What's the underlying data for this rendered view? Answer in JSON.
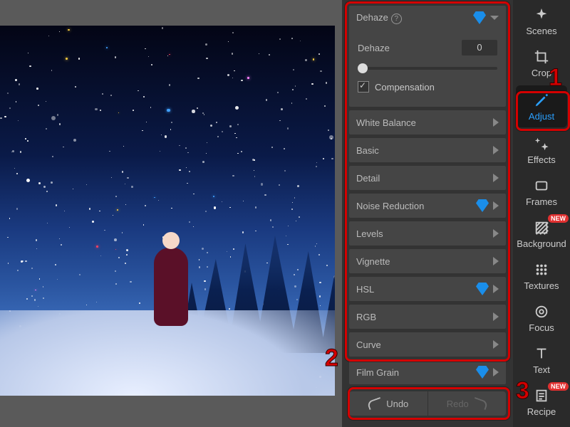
{
  "panelGroup": {
    "dehaze": {
      "header": "Dehaze",
      "hasHelp": true,
      "hasDiamond": true,
      "param_label": "Dehaze",
      "param_value": "0",
      "comp_label": "Compensation",
      "comp_checked": true
    },
    "items": [
      {
        "label": "White Balance",
        "diamond": false
      },
      {
        "label": "Basic",
        "diamond": false
      },
      {
        "label": "Detail",
        "diamond": false
      },
      {
        "label": "Noise Reduction",
        "diamond": true
      },
      {
        "label": "Levels",
        "diamond": false
      },
      {
        "label": "Vignette",
        "diamond": false
      },
      {
        "label": "HSL",
        "diamond": true
      },
      {
        "label": "RGB",
        "diamond": false
      },
      {
        "label": "Curve",
        "diamond": false
      },
      {
        "label": "Film Grain",
        "diamond": true
      }
    ]
  },
  "undo": {
    "undo_label": "Undo",
    "redo_label": "Redo"
  },
  "tools": [
    {
      "label": "Scenes",
      "icon": "sparkle",
      "new": false
    },
    {
      "label": "Crop",
      "icon": "crop",
      "new": false
    },
    {
      "label": "Adjust",
      "icon": "pencil",
      "new": false,
      "active": true
    },
    {
      "label": "Effects",
      "icon": "sparkles",
      "new": false
    },
    {
      "label": "Frames",
      "icon": "rect",
      "new": false
    },
    {
      "label": "Background",
      "icon": "hatch",
      "new": true
    },
    {
      "label": "Textures",
      "icon": "dots",
      "new": false
    },
    {
      "label": "Focus",
      "icon": "target",
      "new": false
    },
    {
      "label": "Text",
      "icon": "text",
      "new": false
    },
    {
      "label": "Recipe",
      "icon": "list",
      "new": true
    }
  ],
  "callouts": {
    "n1": "1",
    "n2": "2",
    "n3": "3"
  }
}
